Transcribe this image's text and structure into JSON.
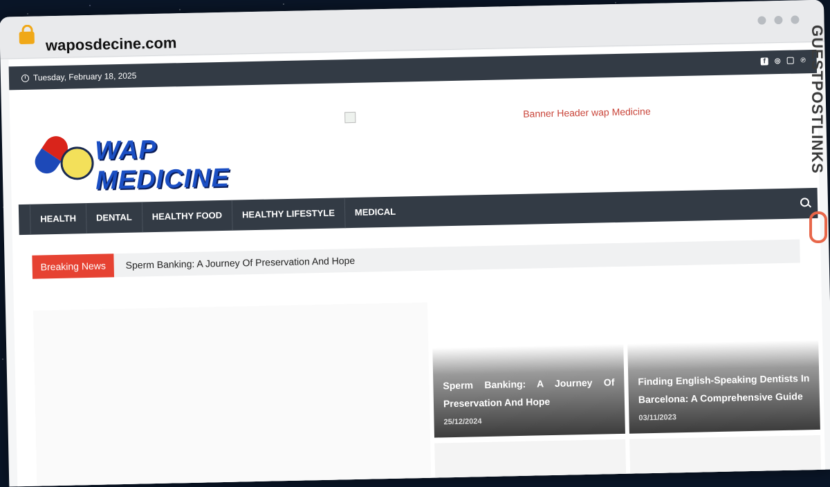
{
  "browser": {
    "url": "waposdecine.com"
  },
  "topbar": {
    "date": "Tuesday, February 18, 2025",
    "social_icons": [
      "facebook-icon",
      "instagram-icon",
      "twitter-icon",
      "pinterest-icon"
    ]
  },
  "header": {
    "logo_text": "WAP MEDICINE",
    "banner_alt": "Banner Header wap Medicine"
  },
  "nav": {
    "items": [
      "HEALTH",
      "DENTAL",
      "HEALTHY FOOD",
      "HEALTHY LIFESTYLE",
      "MEDICAL"
    ]
  },
  "breaking": {
    "label": "Breaking News",
    "headline": "Sperm Banking: A Journey Of Preservation And Hope"
  },
  "featured": [
    {
      "title": "Sperm Banking: A Journey Of Preservation And Hope",
      "date": "25/12/2024"
    },
    {
      "title": "Finding English-Speaking Dentists In Barcelona: A Comprehensive Guide",
      "date": "03/11/2023"
    }
  ],
  "side_brand": {
    "text": "GUESTPOSTLINKS"
  },
  "colors": {
    "nav_bg": "#333b45",
    "breaking_red": "#e64232",
    "logo_blue": "#1b4fc4"
  }
}
